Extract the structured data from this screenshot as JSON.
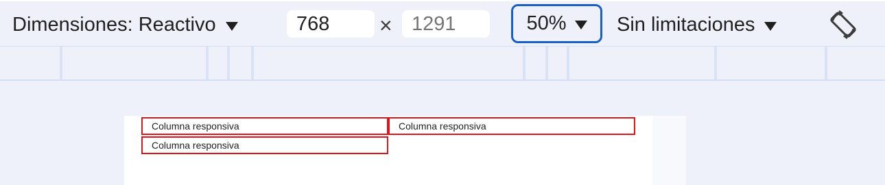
{
  "toolbar": {
    "dimensions_label": "Dimensiones: Reactivo",
    "width_value": "768",
    "height_placeholder": "1291",
    "times_symbol": "×",
    "zoom_label": "50%",
    "throttle_label": "Sin limitaciones",
    "rotate_icon": "rotate-device-icon",
    "caret_icon": "caret-down-icon",
    "accent_color": "#1a5ec8"
  },
  "page": {
    "columns": [
      {
        "label": "Columna responsiva"
      },
      {
        "label": "Columna responsiva"
      },
      {
        "label": "Columna responsiva"
      }
    ],
    "border_color": "#e0151b"
  }
}
